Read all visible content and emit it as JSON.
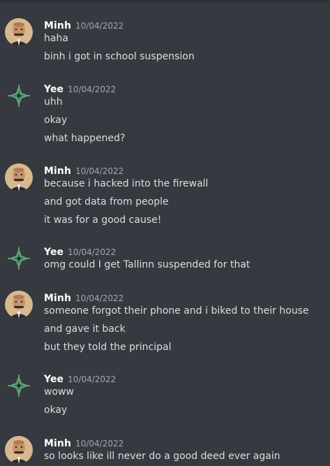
{
  "users": {
    "minh": {
      "name": "Minh",
      "avatar_icon": "person-avatar-icon"
    },
    "yee": {
      "name": "Yee",
      "avatar_icon": "green-sparkle-avatar-icon"
    }
  },
  "groups": [
    {
      "user": "Minh",
      "timestamp": "10/04/2022",
      "messages": [
        "haha",
        "binh i got in school suspension"
      ]
    },
    {
      "user": "Yee",
      "timestamp": "10/04/2022",
      "messages": [
        "uhh",
        "okay",
        "what happened?"
      ]
    },
    {
      "user": "Minh",
      "timestamp": "10/04/2022",
      "messages": [
        "because i hacked into the firewall",
        "and got data from people",
        "it was for a good cause!"
      ]
    },
    {
      "user": "Yee",
      "timestamp": "10/04/2022",
      "messages": [
        "omg could I get Tallinn suspended for that"
      ]
    },
    {
      "user": "Minh",
      "timestamp": "10/04/2022",
      "messages": [
        "someone forgot their phone and i biked to their house",
        "and gave it back",
        "but they told the principal"
      ]
    },
    {
      "user": "Yee",
      "timestamp": "10/04/2022",
      "messages": [
        "woww",
        "okay"
      ]
    },
    {
      "user": "Minh",
      "timestamp": "10/04/2022",
      "messages": [
        "so looks like ill never do a good deed ever again"
      ]
    }
  ],
  "colors": {
    "background": "#36393f",
    "text": "#dcddde",
    "username": "#ffffff",
    "timestamp": "#a3a6aa"
  }
}
